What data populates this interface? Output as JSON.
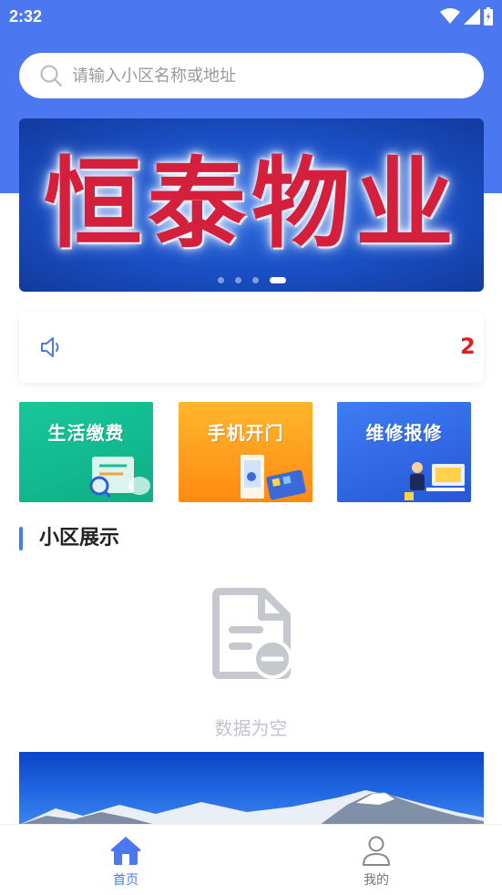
{
  "status_bar": {
    "time": "2:32"
  },
  "search": {
    "placeholder": "请输入小区名称或地址",
    "value": ""
  },
  "banner": {
    "title": "恒泰物业",
    "dot_count": 4,
    "active_dot": 3
  },
  "notice": {
    "text": "2"
  },
  "services": [
    {
      "label": "生活缴费",
      "color": "#15bf95"
    },
    {
      "label": "手机开门",
      "color": "#ff9e1e"
    },
    {
      "label": "维修报修",
      "color": "#3169e6"
    }
  ],
  "section": {
    "title": "小区展示"
  },
  "empty_state": {
    "text": "数据为空"
  },
  "tabbar": {
    "home_label": "首页",
    "mine_label": "我的",
    "active_color": "#4b78f0",
    "inactive_color": "#777777"
  },
  "colors": {
    "primary": "#4b78f0"
  }
}
